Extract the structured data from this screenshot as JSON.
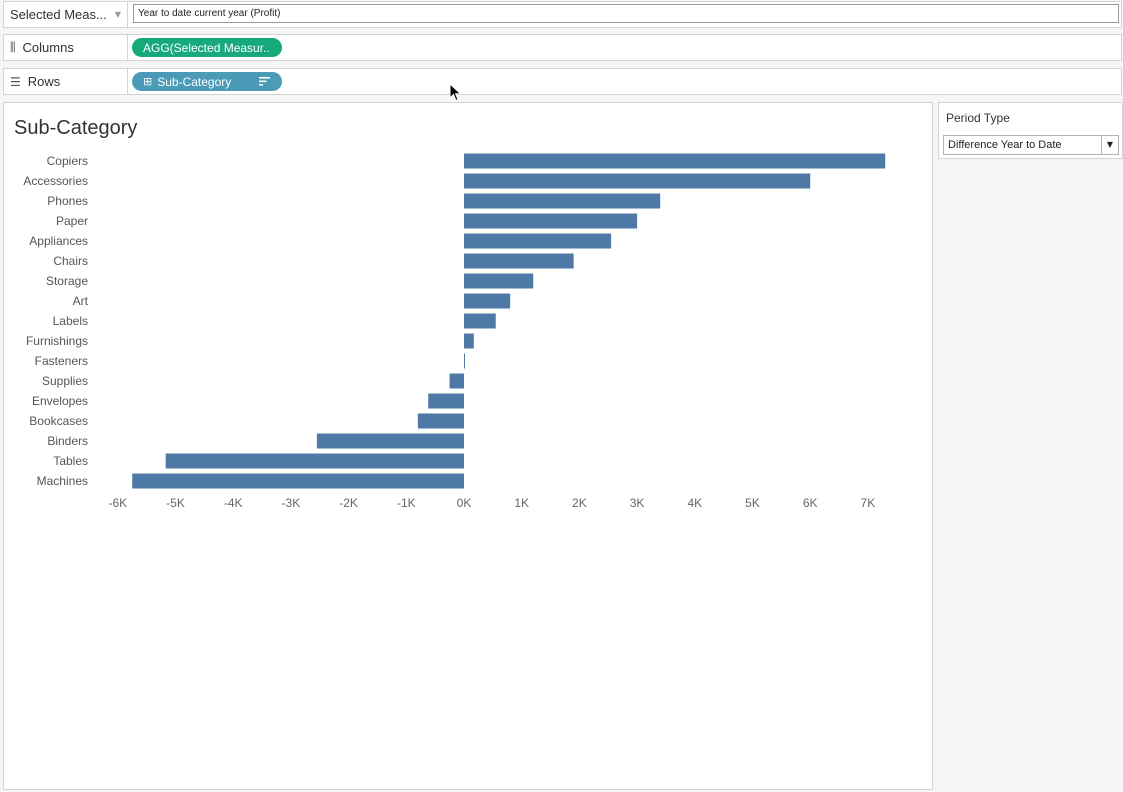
{
  "measure_selector": {
    "label": "Selected Meas..."
  },
  "calc_field": {
    "value": "Year to date current year (Profit)"
  },
  "columns_shelf": {
    "label": "Columns",
    "pill": "AGG(Selected Measur.."
  },
  "rows_shelf": {
    "label": "Rows",
    "pill": "Sub-Category"
  },
  "parameter": {
    "title": "Period Type",
    "value": "Difference Year to Date"
  },
  "colors": {
    "bar": "#4e79a7",
    "columns_pill": "#16a97b",
    "rows_pill": "#4a9ab8"
  },
  "chart_data": {
    "type": "bar",
    "orientation": "horizontal",
    "title": "Sub-Category",
    "categories": [
      "Copiers",
      "Accessories",
      "Phones",
      "Paper",
      "Appliances",
      "Chairs",
      "Storage",
      "Art",
      "Labels",
      "Furnishings",
      "Fasteners",
      "Supplies",
      "Envelopes",
      "Bookcases",
      "Binders",
      "Tables",
      "Machines"
    ],
    "values": [
      7300,
      6000,
      3400,
      3000,
      2550,
      1900,
      1200,
      800,
      550,
      170,
      10,
      -250,
      -620,
      -800,
      -2550,
      -5170,
      -5750
    ],
    "xlim": [
      -6000,
      7000
    ],
    "xticks": [
      "-6K",
      "-5K",
      "-4K",
      "-3K",
      "-2K",
      "-1K",
      "0K",
      "1K",
      "2K",
      "3K",
      "4K",
      "5K",
      "6K",
      "7K"
    ],
    "grid": false
  }
}
